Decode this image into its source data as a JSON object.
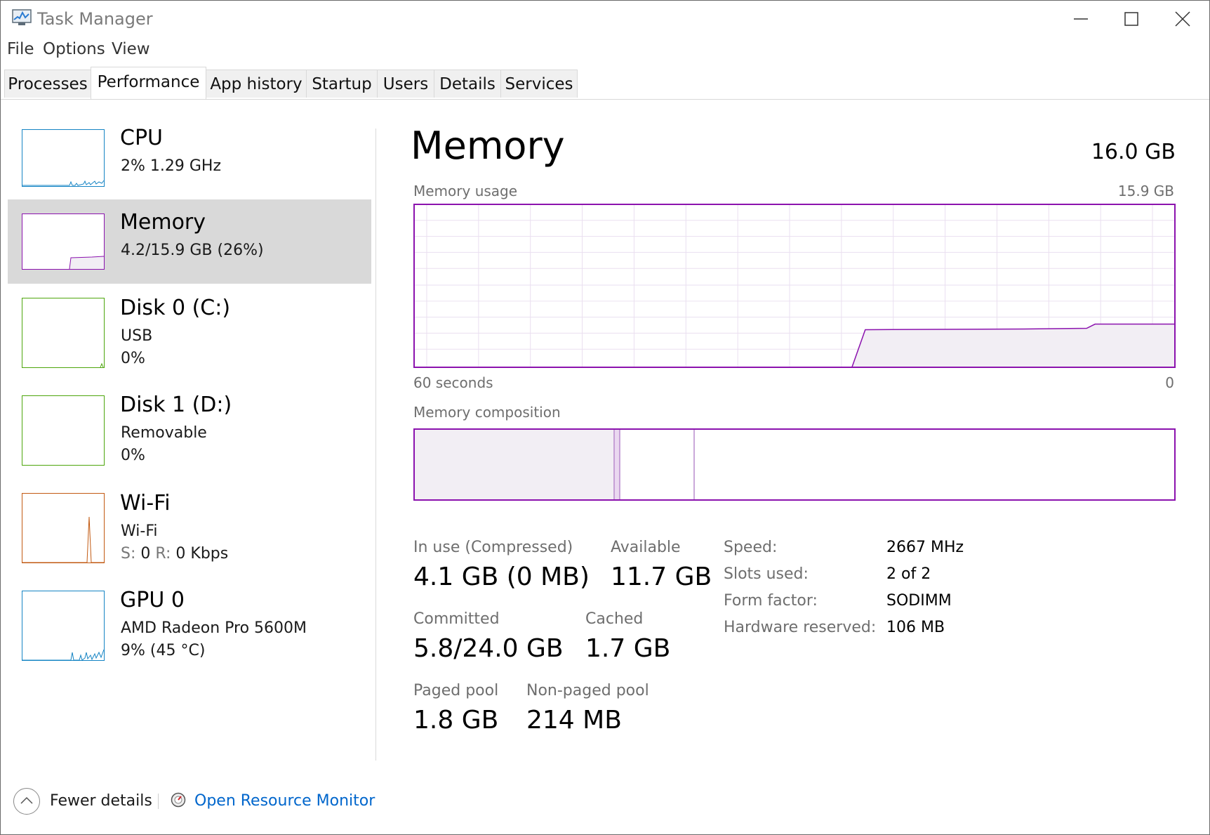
{
  "window": {
    "title": "Task Manager",
    "controls": {
      "minimize": "minimize-icon",
      "maximize": "maximize-icon",
      "close": "close-icon"
    }
  },
  "menu": [
    "File",
    "Options",
    "View"
  ],
  "tabs": [
    "Processes",
    "Performance",
    "App history",
    "Startup",
    "Users",
    "Details",
    "Services"
  ],
  "active_tab": "Performance",
  "sidebar": [
    {
      "title": "CPU",
      "line1": "2%  1.29 GHz",
      "line2": "",
      "color": "#1584c4"
    },
    {
      "title": "Memory",
      "line1": "4.2/15.9 GB (26%)",
      "line2": "",
      "color": "#8b12ae",
      "selected": true
    },
    {
      "title": "Disk 0 (C:)",
      "line1": "USB",
      "line2": "0%",
      "color": "#4da60c"
    },
    {
      "title": "Disk 1 (D:)",
      "line1": "Removable",
      "line2": "0%",
      "color": "#4da60c"
    },
    {
      "title": "Wi-Fi",
      "line1": "Wi-Fi",
      "wifi": {
        "s_label": "S:",
        "s_val": "0",
        "r_label": "R:",
        "r_val": "0 Kbps"
      },
      "color": "#c25a12"
    },
    {
      "title": "GPU 0",
      "line1": "AMD Radeon Pro 5600M",
      "line2": "9% (45 °C)",
      "color": "#1584c4"
    }
  ],
  "main": {
    "title": "Memory",
    "total": "16.0 GB",
    "usage_label": "Memory usage",
    "usage_max": "15.9 GB",
    "time_left": "60 seconds",
    "time_right": "0",
    "composition_label": "Memory composition",
    "accent_color": "#8b12ae",
    "stats": {
      "in_use_label": "In use (Compressed)",
      "in_use": "4.1 GB (0 MB)",
      "available_label": "Available",
      "available": "11.7 GB",
      "committed_label": "Committed",
      "committed": "5.8/24.0 GB",
      "cached_label": "Cached",
      "cached": "1.7 GB",
      "paged_label": "Paged pool",
      "paged": "1.8 GB",
      "nonpaged_label": "Non-paged pool",
      "nonpaged": "214 MB"
    },
    "specs": [
      {
        "label": "Speed:",
        "value": "2667 MHz"
      },
      {
        "label": "Slots used:",
        "value": "2 of 2"
      },
      {
        "label": "Form factor:",
        "value": "SODIMM"
      },
      {
        "label": "Hardware reserved:",
        "value": "106 MB"
      }
    ]
  },
  "footer": {
    "fewer": "Fewer details",
    "resmon": "Open Resource Monitor"
  }
}
